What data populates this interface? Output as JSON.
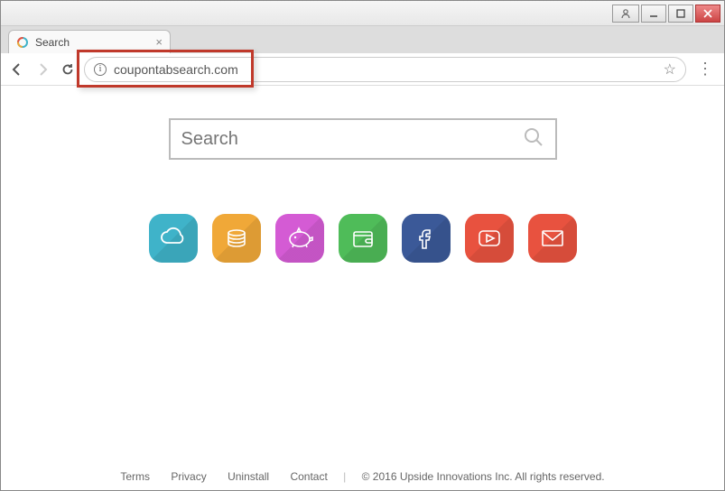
{
  "window": {
    "tab_title": "Search",
    "url": "coupontabsearch.com"
  },
  "search": {
    "placeholder": "Search"
  },
  "shortcuts": [
    {
      "name": "cloud",
      "color": "#3fb3c9"
    },
    {
      "name": "coins",
      "color": "#f0a838"
    },
    {
      "name": "piggy",
      "color": "#d45bd4"
    },
    {
      "name": "wallet",
      "color": "#4fbc59"
    },
    {
      "name": "facebook",
      "color": "#3b5998"
    },
    {
      "name": "youtube",
      "color": "#e8523f"
    },
    {
      "name": "mail",
      "color": "#e8523f"
    }
  ],
  "footer": {
    "links": [
      "Terms",
      "Privacy",
      "Uninstall",
      "Contact"
    ],
    "copyright": "© 2016 Upside Innovations Inc. All rights reserved."
  }
}
